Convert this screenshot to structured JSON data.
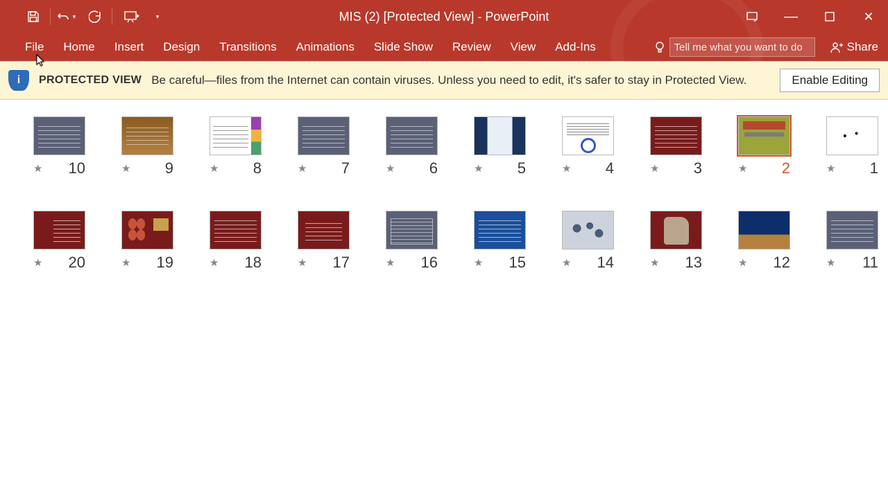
{
  "title": "MIS (2) [Protected View] - PowerPoint",
  "qat": {
    "save": "save-icon",
    "undo": "undo-icon",
    "redo": "redo-icon",
    "present": "present-from-beginning-icon"
  },
  "window_controls": {
    "display_options": "⬚",
    "minimize": "—",
    "restore": "▭",
    "close": "✕"
  },
  "ribbon_tabs": [
    "File",
    "Home",
    "Insert",
    "Design",
    "Transitions",
    "Animations",
    "Slide Show",
    "Review",
    "View",
    "Add-Ins"
  ],
  "tell_me_placeholder": "Tell me what you want to do",
  "share_label": "Share",
  "protected_view": {
    "badge": "PROTECTED VIEW",
    "message": "Be careful—files from the Internet can contain viruses. Unless you need to edit, it's safer to stay in Protected View.",
    "enable_button": "Enable Editing"
  },
  "selected_slide": 2,
  "slides": [
    {
      "n": 1,
      "style": "t-calligraphy"
    },
    {
      "n": 2,
      "style": "t-olive"
    },
    {
      "n": 3,
      "style": "t-darkred"
    },
    {
      "n": 4,
      "style": "t-white-spiral"
    },
    {
      "n": 5,
      "style": "t-faces"
    },
    {
      "n": 6,
      "style": "t-slate"
    },
    {
      "n": 7,
      "style": "t-slate"
    },
    {
      "n": 8,
      "style": "t-medals"
    },
    {
      "n": 9,
      "style": "t-brown"
    },
    {
      "n": 10,
      "style": "t-slate"
    },
    {
      "n": 11,
      "style": "t-slate"
    },
    {
      "n": 12,
      "style": "t-blue-horizon"
    },
    {
      "n": 13,
      "style": "t-cave"
    },
    {
      "n": 14,
      "style": "t-people"
    },
    {
      "n": 15,
      "style": "t-blue"
    },
    {
      "n": 16,
      "style": "t-slate-box"
    },
    {
      "n": 17,
      "style": "t-darkred-center"
    },
    {
      "n": 18,
      "style": "t-darkred"
    },
    {
      "n": 19,
      "style": "t-icons"
    },
    {
      "n": 20,
      "style": "t-list"
    }
  ]
}
